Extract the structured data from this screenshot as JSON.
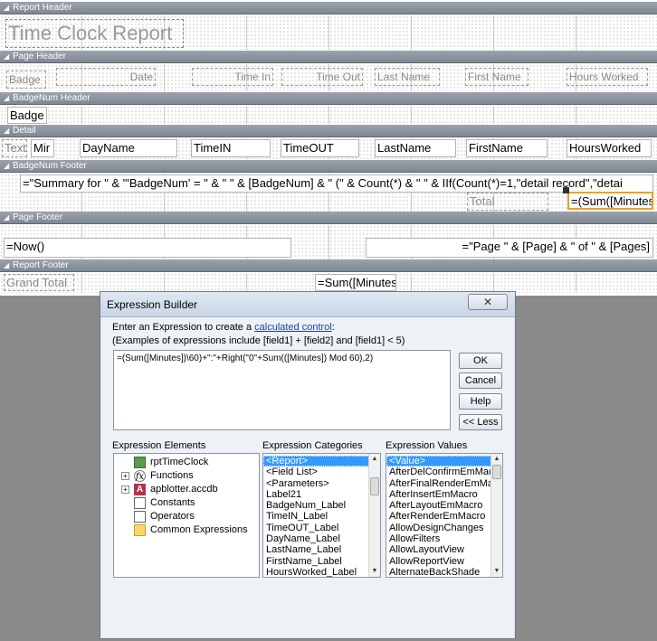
{
  "sections": {
    "report_header": "Report Header",
    "page_header": "Page Header",
    "badgenum_header": "BadgeNum Header",
    "detail": "Detail",
    "badgenum_footer": "BadgeNum Footer",
    "page_footer": "Page Footer",
    "report_footer": "Report Footer"
  },
  "report_title": "Time Clock Report",
  "page_header_labels": [
    "Badge",
    "Date",
    "Time In",
    "Time Out",
    "Last Name",
    "First Name",
    "Hours Worked"
  ],
  "badge_group_control": "Badge",
  "detail_controls": [
    "Text",
    "Mir",
    "DayName",
    "TimeIN",
    "TimeOUT",
    "LastName",
    "FirstName",
    "HoursWorked"
  ],
  "summary_expression": "=\"Summary for \" & \"'BadgeNum' = \" & \" \" & [BadgeNum] & \" (\" & Count(*) & \" \" & IIf(Count(*)=1,\"detail record\",\"detai",
  "total_label": "Total",
  "total_expression": "=(Sum([Minutes",
  "now_expression": "=Now()",
  "page_expression": "=\"Page \" & [Page] & \" of \" & [Pages]",
  "grand_total_label": "Grand Total",
  "grand_total_expression": "=Sum([Minutes",
  "dialog": {
    "title": "Expression Builder",
    "close_label": "✕",
    "prompt_prefix": "Enter an Expression to create a ",
    "prompt_link": "calculated control",
    "prompt_suffix": ":",
    "examples": "(Examples of expressions include [field1] + [field2] and [field1] < 5)",
    "expression": "=(Sum([Minutes])\\60)+\":\"+Right(\"0\"+Sum(([Minutes]) Mod 60),2)",
    "ok_label": "OK",
    "cancel_label": "Cancel",
    "help_label": "Help",
    "less_label": "<< Less",
    "elements_header": "Expression Elements",
    "categories_header": "Expression Categories",
    "values_header": "Expression Values",
    "elements": [
      "rptTimeClock",
      "Functions",
      "apblotter.accdb",
      "Constants",
      "Operators",
      "Common Expressions"
    ],
    "categories": [
      "<Report>",
      "<Field List>",
      "<Parameters>",
      "Label21",
      "BadgeNum_Label",
      "TimeIN_Label",
      "TimeOUT_Label",
      "DayName_Label",
      "LastName_Label",
      "FirstName_Label",
      "HoursWorked_Label"
    ],
    "values": [
      "<Value>",
      "AfterDelConfirmEmMacro",
      "AfterFinalRenderEmMacro",
      "AfterInsertEmMacro",
      "AfterLayoutEmMacro",
      "AfterRenderEmMacro",
      "AllowDesignChanges",
      "AllowFilters",
      "AllowLayoutView",
      "AllowReportView",
      "AlternateBackShade"
    ]
  }
}
